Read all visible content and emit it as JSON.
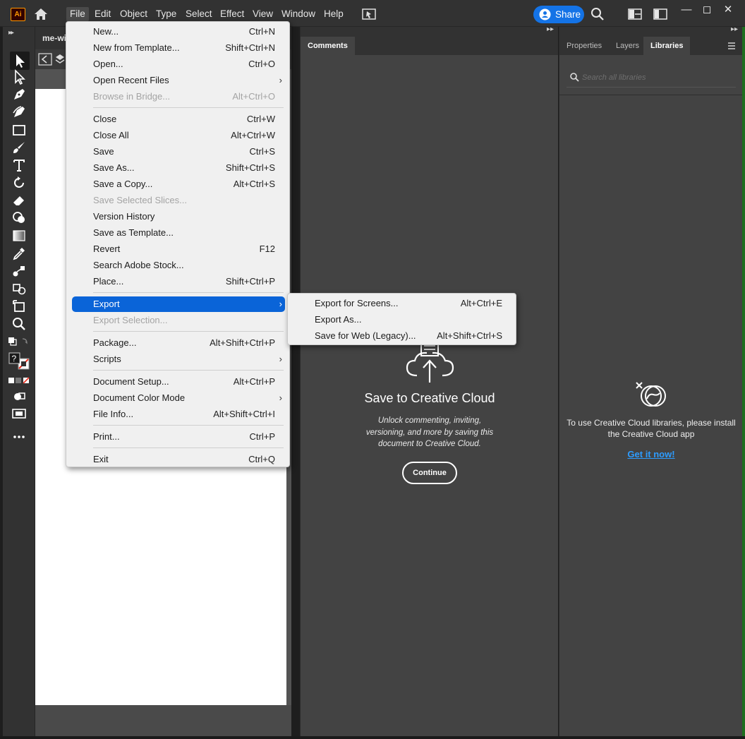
{
  "menubar": {
    "app_badge": "Ai",
    "menus": [
      "File",
      "Edit",
      "Object",
      "Type",
      "Select",
      "Effect",
      "View",
      "Window",
      "Help"
    ],
    "share_label": "Share"
  },
  "document": {
    "tab_label": "me-wi"
  },
  "file_menu": {
    "items": [
      {
        "label": "New...",
        "shortcut": "Ctrl+N"
      },
      {
        "label": "New from Template...",
        "shortcut": "Shift+Ctrl+N"
      },
      {
        "label": "Open...",
        "shortcut": "Ctrl+O"
      },
      {
        "label": "Open Recent Files",
        "shortcut": ""
      },
      {
        "label": "Browse in Bridge...",
        "shortcut": "Alt+Ctrl+O"
      },
      {
        "label": "Close",
        "shortcut": "Ctrl+W"
      },
      {
        "label": "Close All",
        "shortcut": "Alt+Ctrl+W"
      },
      {
        "label": "Save",
        "shortcut": "Ctrl+S"
      },
      {
        "label": "Save As...",
        "shortcut": "Shift+Ctrl+S"
      },
      {
        "label": "Save a Copy...",
        "shortcut": "Alt+Ctrl+S"
      },
      {
        "label": "Save Selected Slices...",
        "shortcut": ""
      },
      {
        "label": "Version History",
        "shortcut": ""
      },
      {
        "label": "Save as Template...",
        "shortcut": ""
      },
      {
        "label": "Revert",
        "shortcut": "F12"
      },
      {
        "label": "Search Adobe Stock...",
        "shortcut": ""
      },
      {
        "label": "Place...",
        "shortcut": "Shift+Ctrl+P"
      },
      {
        "label": "Export",
        "shortcut": ""
      },
      {
        "label": "Export Selection...",
        "shortcut": ""
      },
      {
        "label": "Package...",
        "shortcut": "Alt+Shift+Ctrl+P"
      },
      {
        "label": "Scripts",
        "shortcut": ""
      },
      {
        "label": "Document Setup...",
        "shortcut": "Alt+Ctrl+P"
      },
      {
        "label": "Document Color Mode",
        "shortcut": ""
      },
      {
        "label": "File Info...",
        "shortcut": "Alt+Shift+Ctrl+I"
      },
      {
        "label": "Print...",
        "shortcut": "Ctrl+P"
      },
      {
        "label": "Exit",
        "shortcut": "Ctrl+Q"
      }
    ]
  },
  "export_submenu": {
    "items": [
      {
        "label": "Export for Screens...",
        "shortcut": "Alt+Ctrl+E"
      },
      {
        "label": "Export As...",
        "shortcut": ""
      },
      {
        "label": "Save for Web (Legacy)...",
        "shortcut": "Alt+Shift+Ctrl+S"
      }
    ]
  },
  "comments_panel": {
    "tab_label": "Comments",
    "title": "Save to Creative Cloud",
    "description": "Unlock commenting, inviting, versioning, and more by saving this document to Creative Cloud.",
    "button_label": "Continue"
  },
  "libraries_panel": {
    "tabs": [
      "Properties",
      "Layers",
      "Libraries"
    ],
    "active_tab": "Libraries",
    "search_placeholder": "Search all libraries",
    "message": "To use Creative Cloud libraries, please install the Creative Cloud app",
    "link_label": "Get it now!"
  },
  "colors": {
    "chrome": "#323232",
    "panel": "#434343",
    "accent": "#1473e6",
    "menu_highlight": "#0a64d8",
    "link": "#2d9cff"
  },
  "icons": {
    "toolbar": [
      "selection-tool-icon",
      "direct-selection-tool-icon",
      "pen-tool-icon",
      "curvature-tool-icon",
      "rectangle-tool-icon",
      "paintbrush-tool-icon",
      "type-tool-icon",
      "rotate-tool-icon",
      "eraser-tool-icon",
      "shape-builder-tool-icon",
      "gradient-tool-icon",
      "eyedropper-tool-icon",
      "blend-tool-icon",
      "symbol-sprayer-tool-icon",
      "artboard-tool-icon",
      "zoom-tool-icon",
      "fill-stroke-icon",
      "draw-mode-icon",
      "screen-mode-icon",
      "more-tools-icon"
    ]
  }
}
